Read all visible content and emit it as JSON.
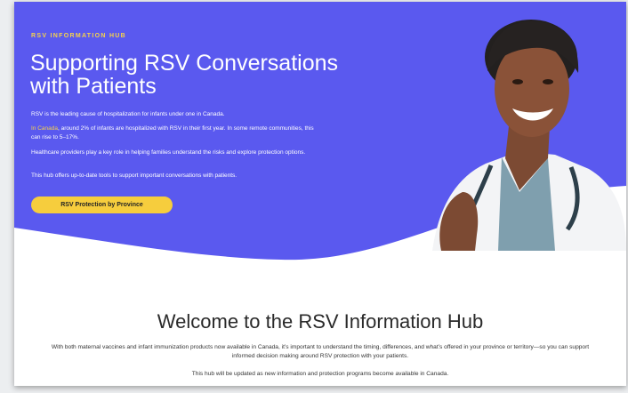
{
  "colors": {
    "hero_bg": "#5a59ef",
    "accent_yellow": "#f6d24a",
    "button_bg": "#f6cd3d"
  },
  "hero": {
    "eyebrow": "RSV INFORMATION HUB",
    "title_line1": "Supporting RSV Conversations",
    "title_line2": "with Patients",
    "para1": "RSV is the leading cause of hospitalization for infants under one in Canada.",
    "para2_highlight": "In Canada",
    "para2_rest": ", around 2% of infants are hospitalized with RSV in their first year. In some remote communities, this can rise to 5–17%.",
    "para3": "Healthcare providers play a key role in helping families understand the risks and explore protection options.",
    "para4": "This hub offers up-to-date tools to support important conversations with patients.",
    "cta_label": "RSV Protection by Province"
  },
  "welcome": {
    "title": "Welcome to the RSV Information Hub",
    "para1": "With both maternal vaccines and infant immunization products now available in Canada, it’s important to understand the timing, differences, and what’s offered in your province or territory—so you can support informed decision making around RSV protection with your patients.",
    "para2": "This hub will be updated as new information and protection programs become available in Canada."
  }
}
